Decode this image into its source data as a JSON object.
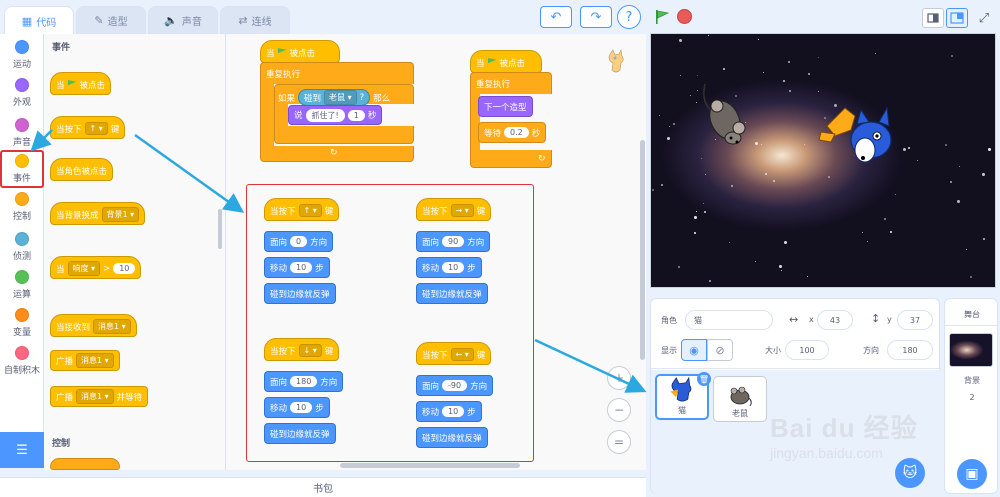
{
  "tabs": {
    "code": "代码",
    "costumes": "造型",
    "sounds": "声音",
    "connect": "连线"
  },
  "toolbar": {
    "undo": "↶",
    "redo": "↷",
    "help": "?"
  },
  "categories": [
    {
      "label": "运动",
      "color": "#4c97ff"
    },
    {
      "label": "外观",
      "color": "#9966ff"
    },
    {
      "label": "声音",
      "color": "#cf63cf"
    },
    {
      "label": "事件",
      "color": "#ffbf00"
    },
    {
      "label": "控制",
      "color": "#ffab19"
    },
    {
      "label": "侦测",
      "color": "#5cb1d6"
    },
    {
      "label": "运算",
      "color": "#59c059"
    },
    {
      "label": "变量",
      "color": "#ff8c1a"
    },
    {
      "label": "自制积木",
      "color": "#ff6680"
    }
  ],
  "palette": {
    "section_events": "事件",
    "section_control": "控制",
    "when_flag_a": "当",
    "when_flag_b": "被点击",
    "when_key": "当按下",
    "key_up": "↑",
    "key_suffix": "键",
    "when_sprite_clicked": "当角色被点击",
    "when_backdrop": "当背景换成",
    "backdrop1": "背景1",
    "when_a": "当",
    "loudness": "响度",
    "gt": ">",
    "ten": "10",
    "when_receive": "当接收到",
    "message1": "消息1",
    "broadcast": "广播",
    "broadcast_wait": "并等待"
  },
  "script1": {
    "when_a": "当",
    "when_b": "被点击",
    "forever": "重复执行",
    "if": "如果",
    "touching": "碰到",
    "mouse": "老鼠",
    "q": "?",
    "then": "那么",
    "say": "说",
    "caught": "抓住了!",
    "one": "1",
    "sec": "秒",
    "loop_arrow": "↻"
  },
  "script2": {
    "when_a": "当",
    "when_b": "被点击",
    "forever": "重复执行",
    "next_costume": "下一个造型",
    "wait": "等待",
    "wait_val": "0.2",
    "sec": "秒",
    "loop_arrow": "↻"
  },
  "key_scripts": [
    {
      "when": "当按下",
      "key": "↑",
      "suffix": "键",
      "point": "面向",
      "dir": "0",
      "dir_label": "方向",
      "move": "移动",
      "steps": "10",
      "steps_label": "步",
      "bounce": "碰到边缘就反弹"
    },
    {
      "when": "当按下",
      "key": "→",
      "suffix": "键",
      "point": "面向",
      "dir": "90",
      "dir_label": "方向",
      "move": "移动",
      "steps": "10",
      "steps_label": "步",
      "bounce": "碰到边缘就反弹"
    },
    {
      "when": "当按下",
      "key": "↓",
      "suffix": "键",
      "point": "面向",
      "dir": "180",
      "dir_label": "方向",
      "move": "移动",
      "steps": "10",
      "steps_label": "步",
      "bounce": "碰到边缘就反弹"
    },
    {
      "when": "当按下",
      "key": "←",
      "suffix": "键",
      "point": "面向",
      "dir": "-90",
      "dir_label": "方向",
      "move": "移动",
      "steps": "10",
      "steps_label": "步",
      "bounce": "碰到边缘就反弹"
    }
  ],
  "zoom": {
    "in": "+",
    "out": "−",
    "reset": "="
  },
  "backpack": "书包",
  "sprite_info": {
    "sprite_label": "角色",
    "sprite_name": "猫",
    "x_label": "x",
    "x_val": "43",
    "y_label": "y",
    "y_val": "37",
    "show_label": "显示",
    "size_label": "大小",
    "size_val": "100",
    "dir_label": "方向",
    "dir_val": "180"
  },
  "sprites": [
    {
      "name": "猫"
    },
    {
      "name": "老鼠"
    }
  ],
  "stage_pane": {
    "title": "舞台",
    "backdrop_label": "背景",
    "backdrop_count": "2"
  },
  "watermark": {
    "brand": "Bai du 经验",
    "url": "jingyan.baidu.com"
  }
}
